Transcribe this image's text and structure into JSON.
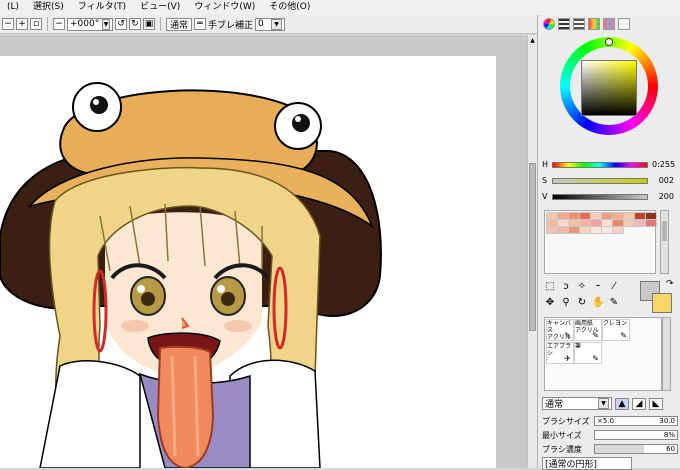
{
  "menu": [
    {
      "label": "(L)"
    },
    {
      "label": "選択(S)"
    },
    {
      "label": "フィルタ(T)"
    },
    {
      "label": "ビュー(V)"
    },
    {
      "label": "ウィンドウ(W)"
    },
    {
      "label": "その他(O)"
    }
  ],
  "toolbar": {
    "rotation_value": "+000°",
    "blend_mode": "通常",
    "stabilizer_label": "手ブレ補正",
    "stabilizer_value": "0"
  },
  "color_panel": {
    "h_label": "H",
    "h_value": "0:255",
    "s_label": "S",
    "s_value": "002",
    "v_label": "V",
    "v_value": "200",
    "accent": "#f0d060"
  },
  "brush_panel": {
    "brushes": [
      {
        "name": "キャンバス\nアクリル"
      },
      {
        "name": "画用紙\nアクリル"
      },
      {
        "name": "クレヨン"
      },
      {
        "name": "エアブラシ"
      },
      {
        "name": "筆"
      }
    ],
    "blend_mode": "通常",
    "brush_size_label": "ブラシサイズ",
    "brush_size_multiplier": "×5.0",
    "brush_size_value": "30.0",
    "min_size_label": "最小サイズ",
    "min_size_value": "8%",
    "density_label": "ブラシ濃度",
    "density_value": "60",
    "shape_label": "[通常の円形]"
  }
}
